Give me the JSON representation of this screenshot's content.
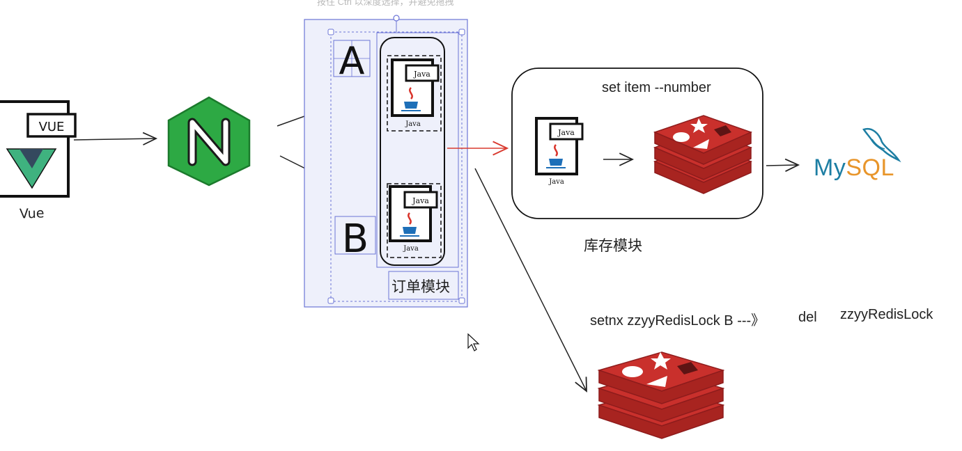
{
  "canvas_hint": "按住 Ctrl 以深度选择，并避免拖拽",
  "vue": {
    "badge": "VUE",
    "caption": "Vue"
  },
  "nginx": {
    "letter": "N"
  },
  "order_module": {
    "label": "订单模块",
    "instances": [
      {
        "tag": "A",
        "java_tag": "Java",
        "java_caption": "Java"
      },
      {
        "tag": "B",
        "java_tag": "Java",
        "java_caption": "Java"
      }
    ]
  },
  "inventory_module": {
    "label": "库存模块",
    "command": "set item --number",
    "java_tag": "Java",
    "java_caption": "Java"
  },
  "mysql": {
    "part1": "My",
    "part2": "SQL"
  },
  "redis_lock": {
    "setnx": "setnx zzyyRedisLock B ---》",
    "del": "del",
    "key": "zzyyRedisLock"
  },
  "colors": {
    "nginx_green": "#2da944",
    "redis_red": "#c9302c",
    "redis_dark": "#8e1c1c",
    "selection_blue": "#6b74d6",
    "arrow_red": "#d93a2f",
    "mysql_blue": "#1d7ea3",
    "mysql_orange": "#e8952a",
    "vue_green": "#3fb27f",
    "vue_dark": "#34495e"
  }
}
